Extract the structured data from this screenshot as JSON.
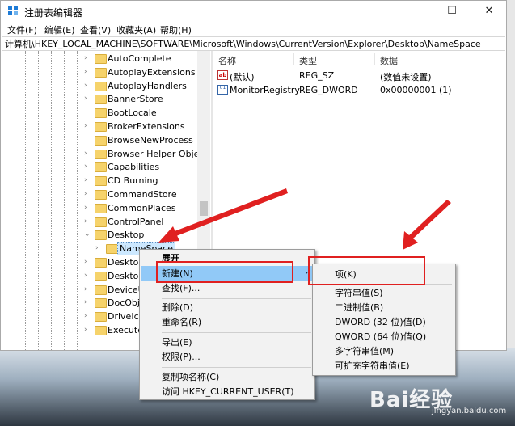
{
  "window": {
    "title": "注册表编辑器",
    "buttons": {
      "minimize": "—",
      "maximize": "☐",
      "close": "✕"
    }
  },
  "menu": [
    "文件(F)",
    "编辑(E)",
    "查看(V)",
    "收藏夹(A)",
    "帮助(H)"
  ],
  "address": "计算机\\HKEY_LOCAL_MACHINE\\SOFTWARE\\Microsoft\\Windows\\CurrentVersion\\Explorer\\Desktop\\NameSpace",
  "tree": {
    "items": [
      {
        "label": "AutoComplete",
        "expander": "›"
      },
      {
        "label": "AutoplayExtensions",
        "expander": "›"
      },
      {
        "label": "AutoplayHandlers",
        "expander": "›"
      },
      {
        "label": "BannerStore",
        "expander": "›"
      },
      {
        "label": "BootLocale",
        "expander": ""
      },
      {
        "label": "BrokerExtensions",
        "expander": "›"
      },
      {
        "label": "BrowseNewProcess",
        "expander": ""
      },
      {
        "label": "Browser Helper Object",
        "expander": "›"
      },
      {
        "label": "Capabilities",
        "expander": "›"
      },
      {
        "label": "CD Burning",
        "expander": "›"
      },
      {
        "label": "CommandStore",
        "expander": "›"
      },
      {
        "label": "CommonPlaces",
        "expander": "›"
      },
      {
        "label": "ControlPanel",
        "expander": "›"
      },
      {
        "label": "Desktop",
        "expander": "⌄"
      },
      {
        "label": "NameSpace",
        "expander": "›"
      },
      {
        "label": "Desktop",
        "expander": "›"
      },
      {
        "label": "Desktop",
        "expander": "›"
      },
      {
        "label": "DeviceU",
        "expander": "›"
      },
      {
        "label": "DocObje",
        "expander": "›"
      },
      {
        "label": "DriveIco",
        "expander": "›"
      },
      {
        "label": "ExecuteT",
        "expander": "›"
      }
    ]
  },
  "values": {
    "headers": {
      "name": "名称",
      "type": "类型",
      "data": "数据"
    },
    "rows": [
      {
        "icon": "ab",
        "name": "(默认)",
        "type": "REG_SZ",
        "data": "(数值未设置)"
      },
      {
        "icon": "01",
        "name": "MonitorRegistry",
        "type": "REG_DWORD",
        "data": "0x00000001 (1)"
      }
    ]
  },
  "context_menu": {
    "items": [
      "展开",
      "新建(N)",
      "查找(F)...",
      "删除(D)",
      "重命名(R)",
      "导出(E)",
      "权限(P)...",
      "复制项名称(C)",
      "访问 HKEY_CURRENT_USER(T)"
    ],
    "submenu_arrow": "›"
  },
  "submenu": {
    "items": [
      "项(K)",
      "字符串值(S)",
      "二进制值(B)",
      "DWORD (32 位)值(D)",
      "QWORD (64 位)值(Q)",
      "多字符串值(M)",
      "可扩充字符串值(E)"
    ]
  },
  "watermark": {
    "text": "Bai经验",
    "sub": "jingyan.baidu.com"
  },
  "colors": {
    "highlight": "#91c9f7",
    "annotation": "#e02020",
    "selected": "#cce8ff"
  }
}
